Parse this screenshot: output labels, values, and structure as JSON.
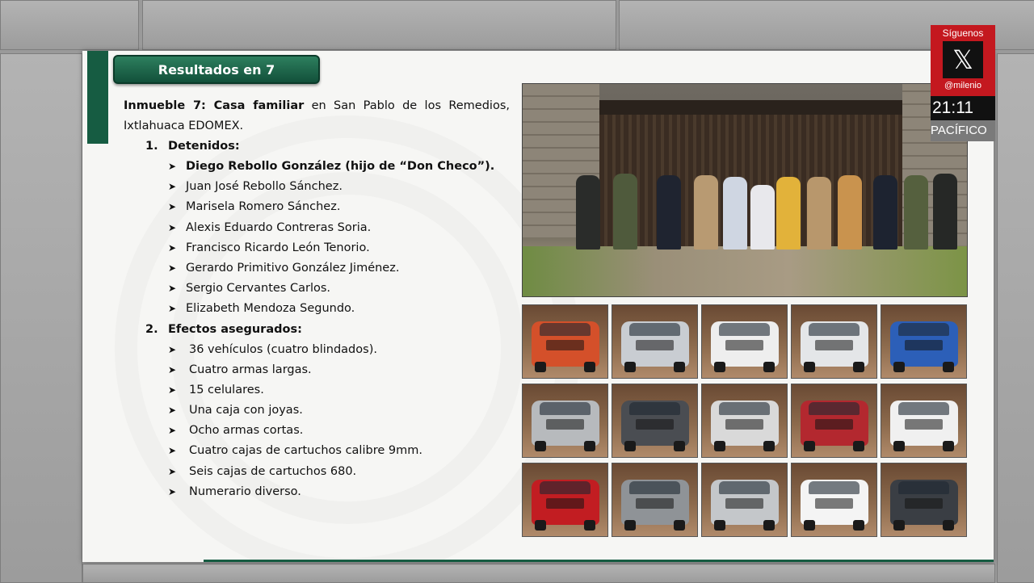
{
  "slide": {
    "title": "Resultados en 7",
    "intro_bold": "Inmueble 7: Casa familiar",
    "intro_rest": " en San Pablo de los Remedios, Ixtlahuaca EDOMEX.",
    "detainees": {
      "number": "1.",
      "heading": "Detenidos:",
      "items": [
        "Diego Rebollo González (hijo de “Don Checo”).",
        "Juan José Rebollo Sánchez.",
        "Marisela Romero Sánchez.",
        "Alexis Eduardo Contreras Soria.",
        "Francisco Ricardo León Tenorio.",
        "Gerardo Primitivo González Jiménez.",
        "Sergio Cervantes Carlos.",
        "Elizabeth Mendoza Segundo."
      ]
    },
    "effects": {
      "number": "2.",
      "heading": "Efectos asegurados:",
      "items": [
        "36 vehículos (cuatro blindados).",
        "Cuatro armas largas.",
        "15 celulares.",
        "Una caja con joyas.",
        "Ocho armas cortas.",
        "Cuatro cajas de cartuchos calibre 9mm.",
        "Seis cajas de cartuchos 680.",
        "Numerario diverso."
      ]
    },
    "bullet_icon": "arrow-bullet-icon",
    "colors": {
      "accent_green": "#165c42",
      "slide_bg": "#f6f6f4"
    }
  },
  "overlay": {
    "follow_label": "Síguenos",
    "social_icon": "x-logo-icon",
    "handle": "@milenio",
    "time": "21:11",
    "zone": "PACÍFICO",
    "colors": {
      "brand_red": "#c4181f"
    }
  },
  "vehicles": [
    {
      "color": "#d4502a"
    },
    {
      "color": "#c9cdd2"
    },
    {
      "color": "#eeeeee"
    },
    {
      "color": "#e4e6e8"
    },
    {
      "color": "#2c5fb8"
    },
    {
      "color": "#b7babd"
    },
    {
      "color": "#4a4d52"
    },
    {
      "color": "#d9d9d9"
    },
    {
      "color": "#b3282f"
    },
    {
      "color": "#f0f0f0"
    },
    {
      "color": "#c21d22"
    },
    {
      "color": "#8f9397"
    },
    {
      "color": "#c4c7ca"
    },
    {
      "color": "#f4f4f4"
    },
    {
      "color": "#3a3e44"
    }
  ]
}
